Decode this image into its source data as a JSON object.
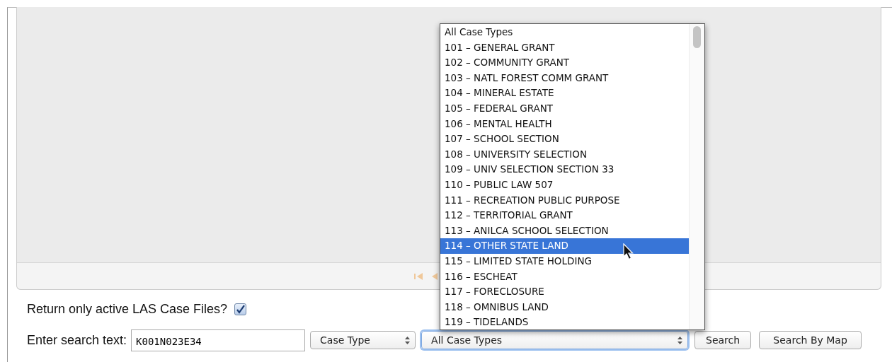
{
  "active_only": {
    "label": "Return only active LAS Case Files?",
    "checked": true
  },
  "search": {
    "label": "Enter search text:",
    "value": "K001N023E34",
    "field_select": "Case Type",
    "case_type_select": "All Case Types",
    "buttons": [
      "Search",
      "Search By Map"
    ]
  },
  "dropdown": {
    "options": [
      {
        "label": "All Case Types",
        "selected": false
      },
      {
        "label": "101 – GENERAL GRANT",
        "selected": false
      },
      {
        "label": "102 – COMMUNITY GRANT",
        "selected": false
      },
      {
        "label": "103 – NATL FOREST COMM GRANT",
        "selected": false
      },
      {
        "label": "104 – MINERAL ESTATE",
        "selected": false
      },
      {
        "label": "105 – FEDERAL GRANT",
        "selected": false
      },
      {
        "label": "106 – MENTAL HEALTH",
        "selected": false
      },
      {
        "label": "107 – SCHOOL SECTION",
        "selected": false
      },
      {
        "label": "108 – UNIVERSITY SELECTION",
        "selected": false
      },
      {
        "label": "109 – UNIV SELECTION SECTION 33",
        "selected": false
      },
      {
        "label": "110 – PUBLIC LAW 507",
        "selected": false
      },
      {
        "label": "111 – RECREATION PUBLIC PURPOSE",
        "selected": false
      },
      {
        "label": "112 – TERRITORIAL GRANT",
        "selected": false
      },
      {
        "label": "113 – ANILCA SCHOOL SELECTION",
        "selected": false
      },
      {
        "label": "114 – OTHER STATE LAND",
        "selected": true
      },
      {
        "label": "115 – LIMITED STATE HOLDING",
        "selected": false
      },
      {
        "label": "116 – ESCHEAT",
        "selected": false
      },
      {
        "label": "117 – FORECLOSURE",
        "selected": false
      },
      {
        "label": "118 – OMNIBUS LAND",
        "selected": false
      },
      {
        "label": "119 – TIDELANDS",
        "selected": false
      }
    ]
  }
}
